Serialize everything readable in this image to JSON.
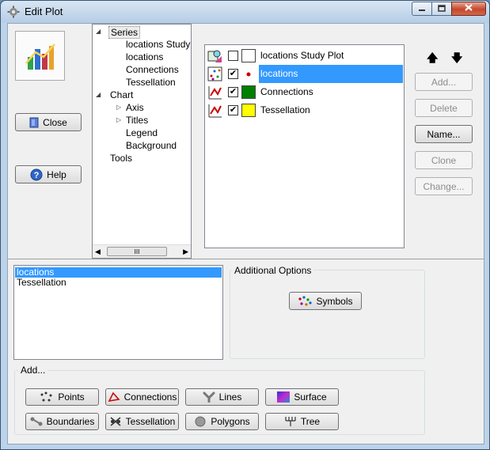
{
  "window": {
    "title": "Edit Plot",
    "title_icon": "gear-icon",
    "controls": [
      "minimize-icon",
      "maximize-icon",
      "close-icon"
    ]
  },
  "left": {
    "chart_icon": "chart-icon",
    "close_label": "Close",
    "help_label": "Help"
  },
  "tree": {
    "series": "Series",
    "series_children": [
      "locations Study P",
      "locations",
      "Connections",
      "Tessellation"
    ],
    "chart": "Chart",
    "chart_children": [
      "Axis",
      "Titles",
      "Legend",
      "Background"
    ],
    "tools": "Tools",
    "scroll_thumb": "III"
  },
  "series_list": [
    {
      "label": "locations Study Plot",
      "checked": false,
      "swatch": "#ffffff",
      "icon": "map-layer-icon"
    },
    {
      "label": "locations",
      "checked": true,
      "swatch": "point",
      "icon": "points-layer-icon",
      "selected": true
    },
    {
      "label": "Connections",
      "checked": true,
      "swatch": "#008000",
      "icon": "connections-layer-icon"
    },
    {
      "label": "Tessellation",
      "checked": true,
      "swatch": "#ffff00",
      "icon": "tessellation-layer-icon"
    }
  ],
  "right_buttons": {
    "add": "Add...",
    "delete": "Delete",
    "name": "Name...",
    "clone": "Clone",
    "change": "Change..."
  },
  "bottom_list": [
    "locations",
    "Tessellation"
  ],
  "additional_options": {
    "label": "Additional Options",
    "symbols": "Symbols"
  },
  "add_group": {
    "label": "Add...",
    "buttons": [
      "Points",
      "Connections",
      "Lines",
      "Surface",
      "Boundaries",
      "Tessellation",
      "Polygons",
      "Tree"
    ]
  }
}
